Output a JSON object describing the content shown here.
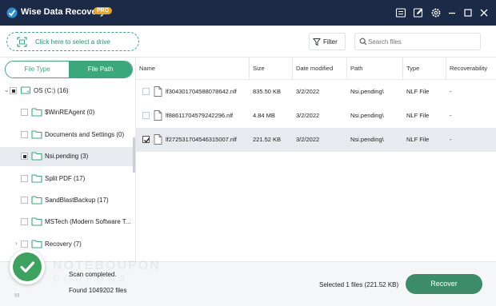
{
  "titlebar": {
    "title": "Wise Data Recovery",
    "badge": "PRO",
    "icons": [
      "menu-icon",
      "edit-icon",
      "settings-icon",
      "minimize-icon",
      "maximize-icon",
      "close-icon"
    ]
  },
  "toolbar": {
    "drive_label": "Click here to select a drive",
    "filter_label": "Filter",
    "search_placeholder": "Search files"
  },
  "sidebar": {
    "tabs": [
      {
        "label": "File Type",
        "active": false
      },
      {
        "label": "File Path",
        "active": true
      }
    ],
    "tree": [
      {
        "label": "OS (C:) (16)",
        "level": 0,
        "expander": "chevron-down",
        "checkbox": "partial",
        "icon": "drive",
        "selected": false
      },
      {
        "label": "$WinREAgent (0)",
        "level": 1,
        "expander": "",
        "checkbox": "none",
        "icon": "folder",
        "selected": false
      },
      {
        "label": "Documents and Settings (0)",
        "level": 1,
        "expander": "",
        "checkbox": "none",
        "icon": "folder",
        "selected": false
      },
      {
        "label": "Nsi.pending (3)",
        "level": 1,
        "expander": "",
        "checkbox": "partial",
        "icon": "folder",
        "selected": true
      },
      {
        "label": "Split PDF (17)",
        "level": 1,
        "expander": "",
        "checkbox": "none",
        "icon": "folder",
        "selected": false
      },
      {
        "label": "SandBlastBackup (17)",
        "level": 1,
        "expander": "",
        "checkbox": "none",
        "icon": "folder",
        "selected": false
      },
      {
        "label": "MSTech (Modern Software T...",
        "level": 1,
        "expander": "",
        "checkbox": "none",
        "icon": "folder",
        "selected": false
      },
      {
        "label": "Recovery (7)",
        "level": 1,
        "expander": "chevron-right",
        "checkbox": "none",
        "icon": "folder",
        "selected": false
      }
    ]
  },
  "table": {
    "columns": [
      "Name",
      "Size",
      "Date modified",
      "Path",
      "Type",
      "Recoverability"
    ],
    "rows": [
      {
        "name": "lf304301704588078642.nlf",
        "size": "835.50 KB",
        "date": "3/2/2022",
        "path": "Nsi.pending\\",
        "type": "NLF File",
        "recoverability": "-",
        "checked": false,
        "selected": false
      },
      {
        "name": "lf88611704579242296.nlf",
        "size": "4.84 MB",
        "date": "3/2/2022",
        "path": "Nsi.pending\\",
        "type": "NLF File",
        "recoverability": "-",
        "checked": false,
        "selected": false
      },
      {
        "name": "lf272531704546315007.nlf",
        "size": "221.52 KB",
        "date": "3/2/2022",
        "path": "Nsi.pending\\",
        "type": "NLF File",
        "recoverability": "-",
        "checked": true,
        "selected": true
      }
    ]
  },
  "status": {
    "line1": "Scan completed.",
    "line2": "Found 1049202 files",
    "selected_info": "Selected 1 files (221.52 KB)",
    "recover_label": "Recover",
    "watermark_line1": "NOTEBOUPON",
    "watermark_line2": "COUPONS"
  },
  "colors": {
    "titlebar_bg": "#1b2a47",
    "accent_green": "#3aa87c",
    "recover_button": "#3c8c6a",
    "pro_badge": "#f0a419",
    "success_badge": "#3ca35f",
    "selection_bg": "#e7ebef"
  }
}
